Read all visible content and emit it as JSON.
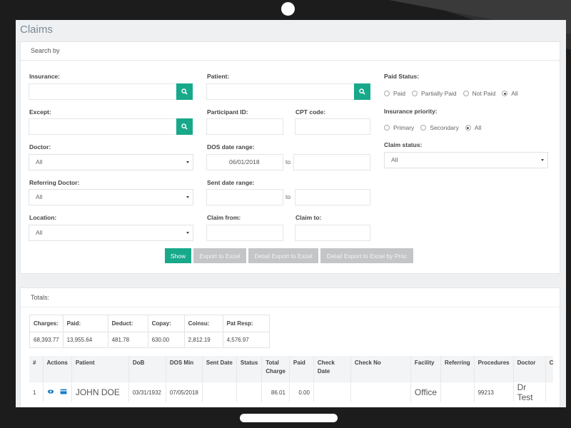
{
  "page_title": "Claims",
  "search": {
    "heading": "Search by",
    "insurance_label": "Insurance:",
    "except_label": "Except:",
    "doctor_label": "Doctor:",
    "doctor_value": "All",
    "referring_doctor_label": "Referring Doctor:",
    "referring_doctor_value": "All",
    "location_label": "Location:",
    "location_value": "All",
    "patient_label": "Patient:",
    "participant_id_label": "Participant ID:",
    "cpt_code_label": "CPT code:",
    "dos_range_label": "DOS date range:",
    "dos_from": "06/01/2018",
    "to_label": "to",
    "sent_range_label": "Sent date range:",
    "claim_from_label": "Claim from:",
    "claim_to_label": "Claim to:",
    "paid_status_label": "Paid Status:",
    "paid_status_options": [
      "Paid",
      "Partially Paid",
      "Not Paid",
      "All"
    ],
    "paid_status_selected": "All",
    "insurance_priority_label": "Insurance priority:",
    "insurance_priority_options": [
      "Primary",
      "Secondary",
      "All"
    ],
    "insurance_priority_selected": "All",
    "claim_status_label": "Claim status:",
    "claim_status_value": "All"
  },
  "buttons": {
    "show": "Show",
    "export_excel": "Export to Excel",
    "detail_export_excel": "Detail Export to Excel",
    "detail_export_excel_proc": "Detail Export to Excel by Proc"
  },
  "totals": {
    "heading": "Totals:",
    "headers": [
      "Charges:",
      "Paid:",
      "Deduct:",
      "Copay:",
      "Coinsu:",
      "Pat Resp:"
    ],
    "values": [
      "68,393.77",
      "13,955.64",
      "481.78",
      "630.00",
      "2,812.19",
      "4,576.97"
    ]
  },
  "claims_table": {
    "headers": [
      "#",
      "Actions",
      "Patient",
      "DoB",
      "DOS Min",
      "Sent Date",
      "Status",
      "Total Charge",
      "Paid",
      "Check Date",
      "Check No",
      "Facility",
      "Referring",
      "Procedures",
      "Doctor",
      "C"
    ],
    "rows": [
      {
        "num": "1",
        "patient": "JOHN DOE",
        "dob": "03/31/1932",
        "dos_min": "07/05/2018",
        "sent_date": "",
        "status": "",
        "total_charge": "86.01",
        "paid": "0.00",
        "check_date": "",
        "check_no": "",
        "facility": "Office",
        "referring": "",
        "procedures": "99213",
        "doctor": "Dr Test"
      }
    ]
  },
  "colors": {
    "accent": "#17a98a",
    "disabled_button": "#c3c5c7",
    "device_frame": "#1c1c1c"
  },
  "icons": {
    "search": "search-icon",
    "view": "eye-icon",
    "card": "card-icon"
  }
}
